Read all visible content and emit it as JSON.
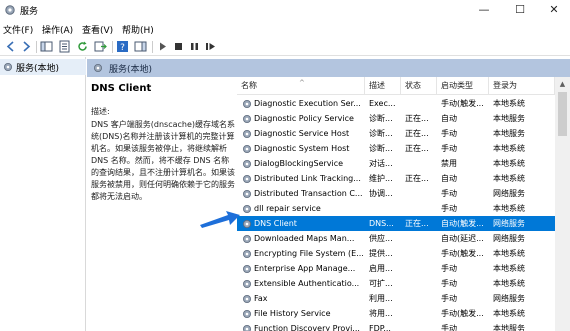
{
  "window": {
    "title": "服务",
    "controls": {
      "minimize": "—",
      "maximize": "☐",
      "close": "✕"
    }
  },
  "menu": [
    {
      "label": "文件(F)"
    },
    {
      "label": "操作(A)"
    },
    {
      "label": "查看(V)"
    },
    {
      "label": "帮助(H)"
    }
  ],
  "tree": {
    "item": "服务(本地)"
  },
  "header": {
    "title": "服务(本地)"
  },
  "description": {
    "service_name": "DNS Client",
    "label": "描述:",
    "text": "DNS 客户端服务(dnscache)缓存域名系统(DNS)名称并注册该计算机的完整计算机名。如果该服务被停止，将继续解析 DNS 名称。然而，将不缓存 DNS 名称的查询结果，且不注册计算机名。如果该服务被禁用，则任何明确依赖于它的服务都将无法启动。"
  },
  "columns": {
    "name": "名称",
    "desc": "描述",
    "status": "状态",
    "startup": "启动类型",
    "logon": "登录为"
  },
  "rows": [
    {
      "name": "Diagnostic Execution Ser...",
      "desc": "Exec...",
      "status": "",
      "startup": "手动(触发...",
      "logon": "本地系统"
    },
    {
      "name": "Diagnostic Policy Service",
      "desc": "诊断...",
      "status": "正在...",
      "startup": "自动",
      "logon": "本地服务"
    },
    {
      "name": "Diagnostic Service Host",
      "desc": "诊断...",
      "status": "正在...",
      "startup": "手动",
      "logon": "本地服务"
    },
    {
      "name": "Diagnostic System Host",
      "desc": "诊断...",
      "status": "正在...",
      "startup": "手动",
      "logon": "本地系统"
    },
    {
      "name": "DialogBlockingService",
      "desc": "对话...",
      "status": "",
      "startup": "禁用",
      "logon": "本地系统"
    },
    {
      "name": "Distributed Link Tracking...",
      "desc": "维护...",
      "status": "正在...",
      "startup": "自动",
      "logon": "本地系统"
    },
    {
      "name": "Distributed Transaction C...",
      "desc": "协调...",
      "status": "",
      "startup": "手动",
      "logon": "网络服务"
    },
    {
      "name": "dll repair service",
      "desc": "",
      "status": "",
      "startup": "手动",
      "logon": "本地系统"
    },
    {
      "name": "DNS Client",
      "desc": "DNS...",
      "status": "正在...",
      "startup": "自动(触发...",
      "logon": "网络服务",
      "selected": true
    },
    {
      "name": "Downloaded Maps Man...",
      "desc": "供应...",
      "status": "",
      "startup": "自动(延迟...",
      "logon": "网络服务"
    },
    {
      "name": "Encrypting File System (E...",
      "desc": "提供...",
      "status": "",
      "startup": "手动(触发...",
      "logon": "本地系统"
    },
    {
      "name": "Enterprise App Manage...",
      "desc": "启用...",
      "status": "",
      "startup": "手动",
      "logon": "本地系统"
    },
    {
      "name": "Extensible Authenticatio...",
      "desc": "可扩...",
      "status": "",
      "startup": "手动",
      "logon": "本地系统"
    },
    {
      "name": "Fax",
      "desc": "利用...",
      "status": "",
      "startup": "手动",
      "logon": "网络服务"
    },
    {
      "name": "File History Service",
      "desc": "将用...",
      "status": "",
      "startup": "手动(触发...",
      "logon": "本地系统"
    },
    {
      "name": "Function Discovery Provi...",
      "desc": "FDP...",
      "status": "",
      "startup": "手动",
      "logon": "本地服务"
    }
  ],
  "colors": {
    "selection": "#0078d7",
    "header_band": "#b3c5df",
    "arrow": "#1e6fd9"
  },
  "icons": {
    "app": "gear-icon",
    "service": "gear-icon"
  }
}
